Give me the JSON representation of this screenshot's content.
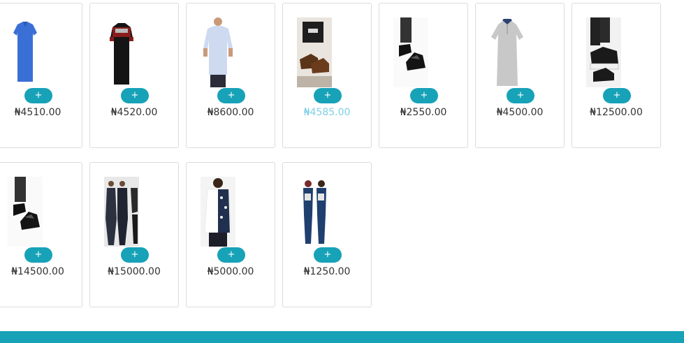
{
  "add_label": "+",
  "rows": [
    [
      {
        "id": "blue-polo",
        "price": "₦4510.00"
      },
      {
        "id": "black-embroidered-kaftan",
        "price": "₦4520.00"
      },
      {
        "id": "light-blue-shirt",
        "price": "₦8600.00"
      },
      {
        "id": "brown-leather-shoes",
        "price": "₦4585.00",
        "hover": true
      },
      {
        "id": "black-slip-on-shoes",
        "price": "₦2550.00"
      },
      {
        "id": "grey-polo-dress",
        "price": "₦4500.00"
      },
      {
        "id": "black-platform-sneakers",
        "price": "₦12500.00"
      }
    ],
    [
      {
        "id": "black-loafers",
        "price": "₦14500.00"
      },
      {
        "id": "mens-suits",
        "price": "₦15000.00"
      },
      {
        "id": "patterned-native-wear",
        "price": "₦5000.00"
      },
      {
        "id": "couple-matching-outfits",
        "price": "₦1250.00"
      }
    ]
  ],
  "colors": {
    "accent": "#17a2b8",
    "price_text": "#333333",
    "price_hover": "#7fcfe6"
  }
}
